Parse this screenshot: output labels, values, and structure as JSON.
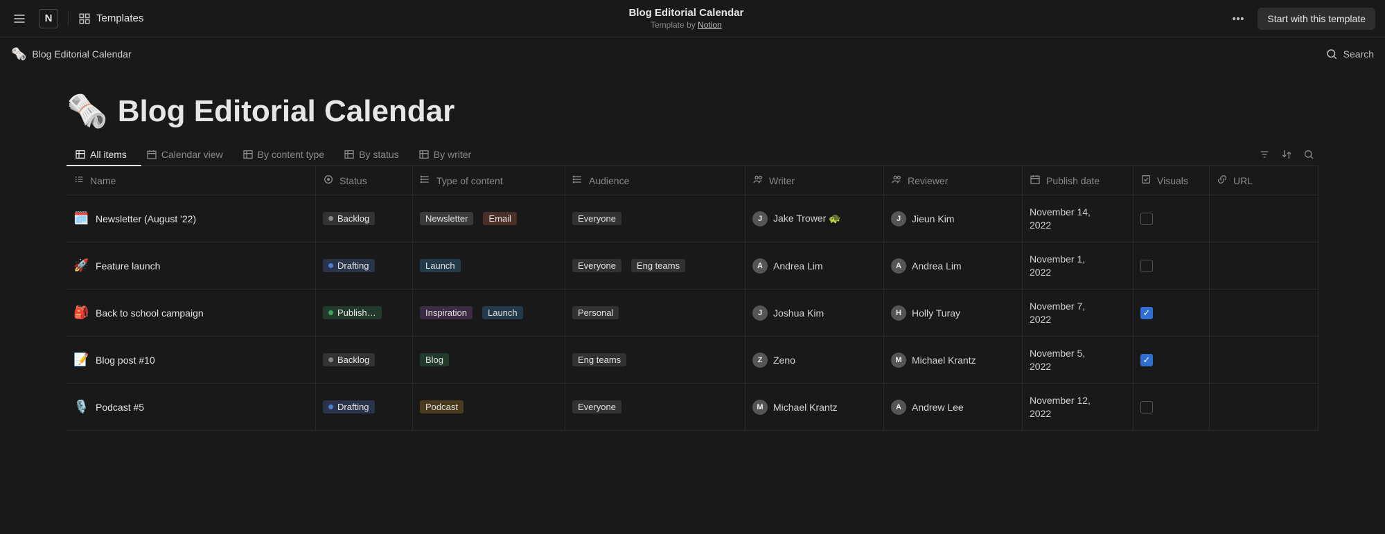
{
  "topbar": {
    "templates_label": "Templates",
    "title": "Blog Editorial Calendar",
    "byline_prefix": "Template by ",
    "byline_author": "Notion",
    "start_button": "Start with this template",
    "notion_glyph": "N"
  },
  "breadcrumb": {
    "emoji": "🗞️",
    "label": "Blog Editorial Calendar"
  },
  "search_label": "Search",
  "page": {
    "emoji": "🗞️",
    "title": "Blog Editorial Calendar"
  },
  "views": {
    "tabs": [
      {
        "label": "All items",
        "active": true
      },
      {
        "label": "Calendar view",
        "active": false
      },
      {
        "label": "By content type",
        "active": false
      },
      {
        "label": "By status",
        "active": false
      },
      {
        "label": "By writer",
        "active": false
      }
    ]
  },
  "columns": {
    "name": "Name",
    "status": "Status",
    "type": "Type of content",
    "audience": "Audience",
    "writer": "Writer",
    "reviewer": "Reviewer",
    "publish": "Publish date",
    "visuals": "Visuals",
    "url": "URL"
  },
  "status_labels": {
    "backlog": "Backlog",
    "drafting": "Drafting",
    "published": "Publish…"
  },
  "tag_labels": {
    "newsletter": "Newsletter",
    "email": "Email",
    "launch": "Launch",
    "inspiration": "Inspiration",
    "blog": "Blog",
    "podcast": "Podcast",
    "everyone": "Everyone",
    "eng": "Eng teams",
    "personal": "Personal"
  },
  "rows": [
    {
      "emoji": "🗓️",
      "name": "Newsletter (August '22)",
      "status": "backlog",
      "type": [
        "newsletter",
        "email"
      ],
      "audience": [
        "everyone"
      ],
      "writer": {
        "name": "Jake Trower 🐢",
        "initial": "J"
      },
      "reviewer": {
        "name": "Jieun Kim",
        "initial": "J"
      },
      "publish": "November 14, 2022",
      "visuals": false
    },
    {
      "emoji": "🚀",
      "name": "Feature launch",
      "status": "drafting",
      "type": [
        "launch"
      ],
      "audience": [
        "everyone",
        "eng"
      ],
      "writer": {
        "name": "Andrea Lim",
        "initial": "A"
      },
      "reviewer": {
        "name": "Andrea Lim",
        "initial": "A"
      },
      "publish": "November 1, 2022",
      "visuals": false
    },
    {
      "emoji": "🎒",
      "name": "Back to school campaign",
      "status": "published",
      "type": [
        "inspiration",
        "launch"
      ],
      "audience": [
        "personal"
      ],
      "writer": {
        "name": "Joshua Kim",
        "initial": "J"
      },
      "reviewer": {
        "name": "Holly Turay",
        "initial": "H"
      },
      "publish": "November 7, 2022",
      "visuals": true
    },
    {
      "emoji": "📝",
      "name": "Blog post #10",
      "status": "backlog",
      "type": [
        "blog"
      ],
      "audience": [
        "eng"
      ],
      "writer": {
        "name": "Zeno",
        "initial": "Z"
      },
      "reviewer": {
        "name": "Michael Krantz",
        "initial": "M"
      },
      "publish": "November 5, 2022",
      "visuals": true
    },
    {
      "emoji": "🎙️",
      "name": "Podcast #5",
      "status": "drafting",
      "type": [
        "podcast"
      ],
      "audience": [
        "everyone"
      ],
      "writer": {
        "name": "Michael Krantz",
        "initial": "M"
      },
      "reviewer": {
        "name": "Andrew Lee",
        "initial": "A"
      },
      "publish": "November 12, 2022",
      "visuals": false
    }
  ]
}
